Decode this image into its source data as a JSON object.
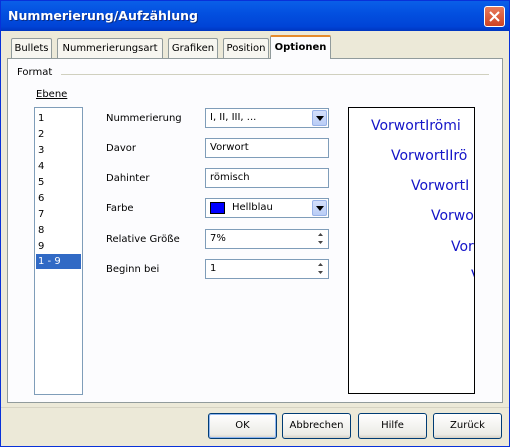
{
  "window": {
    "title": "Nummerierung/Aufzählung"
  },
  "tabs": [
    {
      "label": "Bullets"
    },
    {
      "label": "Nummerierungsart"
    },
    {
      "label": "Grafiken"
    },
    {
      "label": "Position"
    },
    {
      "label": "Optionen",
      "active": true
    }
  ],
  "format": {
    "section_label": "Format",
    "level_label": "Ebene",
    "levels": [
      "1",
      "2",
      "3",
      "4",
      "5",
      "6",
      "7",
      "8",
      "9",
      "1 - 9"
    ],
    "selected_level": "1 - 9",
    "numbering": {
      "label": "Nummerierung",
      "value": "I, II, III, ..."
    },
    "before": {
      "label": "Davor",
      "value": "Vorwort"
    },
    "after": {
      "label": "Dahinter",
      "value": "römisch"
    },
    "color": {
      "label": "Farbe",
      "value": "Hellblau",
      "swatch": "#0000ff"
    },
    "relative_size": {
      "label": "Relative Größe",
      "value": "7%"
    },
    "start_at": {
      "label": "Beginn bei",
      "value": "1"
    }
  },
  "preview": {
    "lines": [
      "VorwortIrömi",
      "VorwortIIrö",
      "VorwortI",
      "Vorwor",
      "Vor",
      "V"
    ]
  },
  "buttons": {
    "ok": "OK",
    "cancel": "Abbrechen",
    "help": "Hilfe",
    "reset": "Zurück"
  }
}
